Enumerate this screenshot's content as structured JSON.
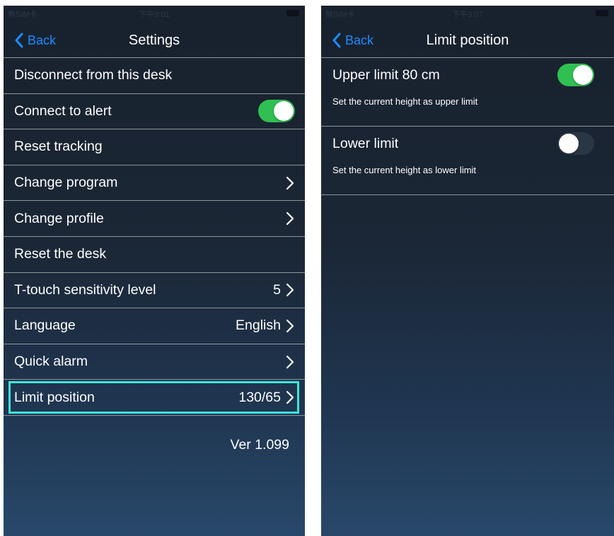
{
  "left_screen": {
    "status": {
      "carrier": "無SIM卡",
      "time": "下午3:01"
    },
    "nav": {
      "back_label": "Back",
      "title": "Settings"
    },
    "items": [
      {
        "label": "Disconnect from this desk"
      },
      {
        "label": "Connect to alert",
        "toggle": "on"
      },
      {
        "label": "Reset tracking"
      },
      {
        "label": "Change program",
        "chevron": true
      },
      {
        "label": "Change profile",
        "chevron": true
      },
      {
        "label": "Reset the desk"
      },
      {
        "label": "T-touch sensitivity level",
        "value": "5",
        "chevron": true
      },
      {
        "label": "Language",
        "value": "English",
        "chevron": true
      },
      {
        "label": "Quick alarm",
        "chevron": true
      },
      {
        "label": "Limit position",
        "value": "130/65",
        "chevron": true,
        "highlighted": true
      }
    ],
    "version": "Ver 1.099"
  },
  "right_screen": {
    "status": {
      "carrier": "無SIM卡",
      "time": "下午3:07"
    },
    "nav": {
      "back_label": "Back",
      "title": "Limit position"
    },
    "upper_limit": {
      "label": "Upper limit 80 cm",
      "toggle": "on",
      "description": "Set the current height as upper limit"
    },
    "lower_limit": {
      "label": "Lower limit",
      "toggle": "off",
      "description": "Set the current height as lower limit"
    }
  },
  "colors": {
    "accent_blue": "#1e8cff",
    "toggle_on": "#30c052",
    "highlight": "#3ee5d9",
    "background_top": "#18212d",
    "background_bottom": "#28486a"
  }
}
